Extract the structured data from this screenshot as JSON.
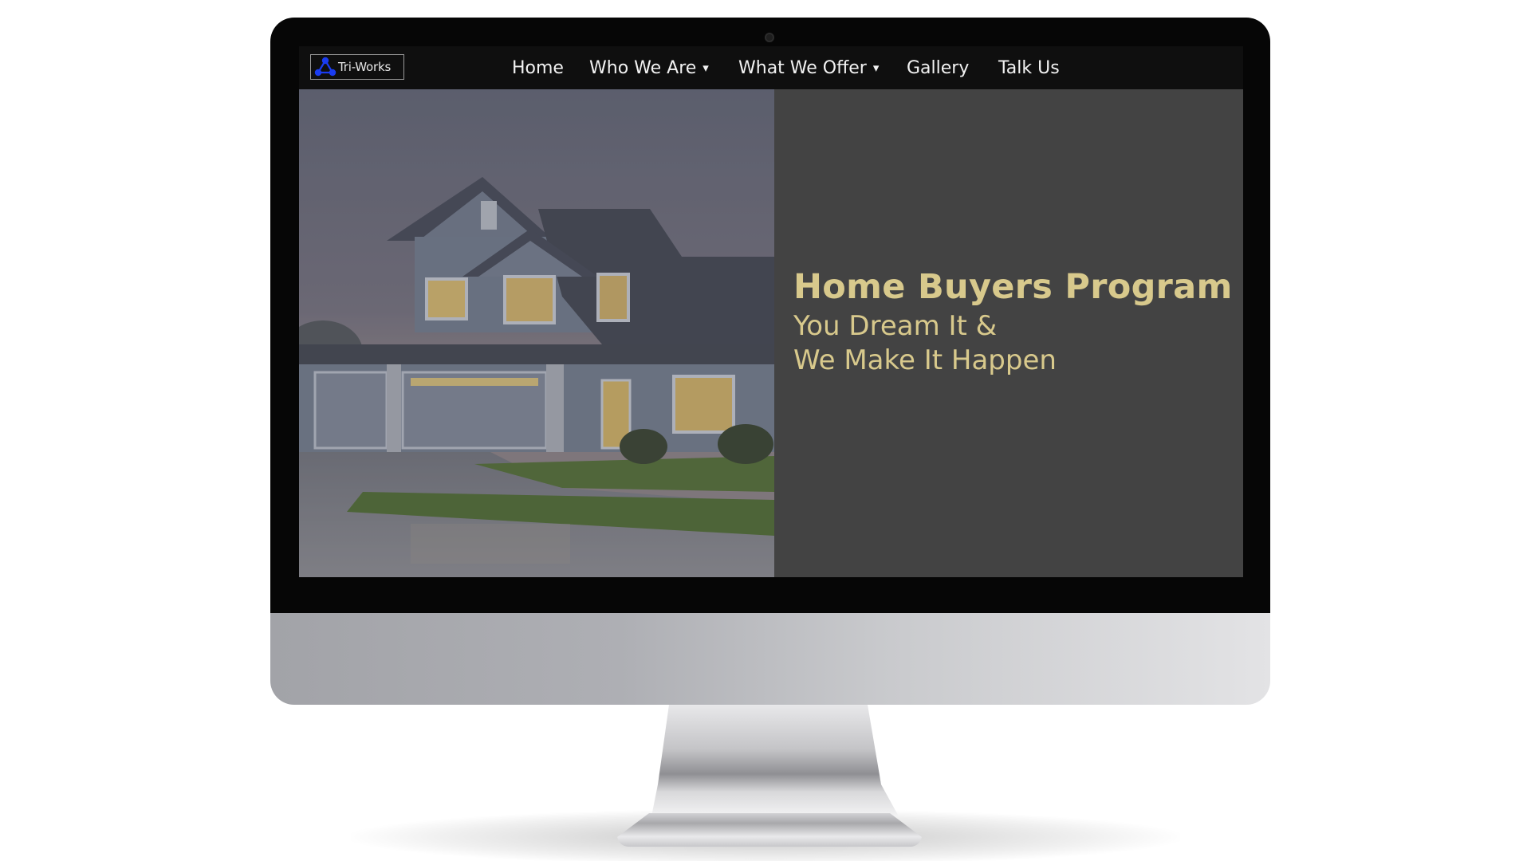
{
  "site": {
    "logo_text": "Tri-Works",
    "logo_icon": "three-node-network-icon",
    "accent_color": "#d8c98c",
    "logo_color": "#1a3cf0"
  },
  "nav": {
    "items": [
      {
        "label": "Home",
        "has_dropdown": false
      },
      {
        "label": "Who We Are",
        "has_dropdown": true
      },
      {
        "label": "What We Offer",
        "has_dropdown": true
      },
      {
        "label": "Gallery",
        "has_dropdown": false
      },
      {
        "label": "Talk Us",
        "has_dropdown": false
      }
    ],
    "dropdown_glyph": "▾"
  },
  "hero": {
    "title": "Home Buyers Program",
    "subtitle_line1": "You Dream It &",
    "subtitle_line2": "We Make It Happen",
    "image_icon": "house-photo"
  }
}
